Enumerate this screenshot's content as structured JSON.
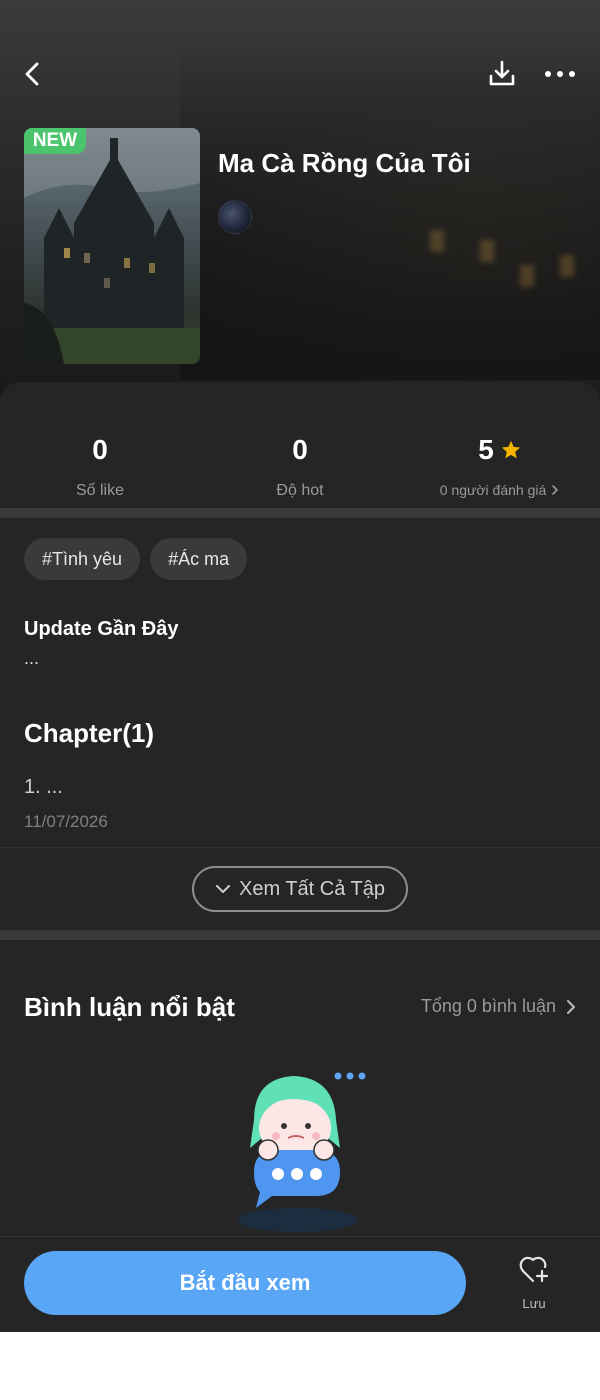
{
  "header": {
    "back_icon": "chevron-left-icon",
    "download_icon": "download-icon",
    "more_icon": "more-dots-icon"
  },
  "story": {
    "title": "Ma Cà Rồng Của Tôi",
    "badge": "NEW"
  },
  "stats": [
    {
      "value": "0",
      "label": "Số like"
    },
    {
      "value": "0",
      "label": "Độ hot"
    },
    {
      "value": "5",
      "label": "0 người đánh giá"
    }
  ],
  "tags": [
    "#Tình yêu",
    "#Ác ma"
  ],
  "update": {
    "title": "Update Gần Đây",
    "text": "..."
  },
  "chapters": {
    "title": "Chapter(1)",
    "items": [
      {
        "name": "1. ...",
        "date": "11/07/2026"
      }
    ],
    "see_all_label": "Xem Tất Cả Tập"
  },
  "comments": {
    "title": "Bình luận nổi bật",
    "total_label": "Tổng 0 bình luận"
  },
  "bottom": {
    "start_label": "Bắt đầu xem",
    "save_label": "Lưu"
  },
  "colors": {
    "background": "#252525",
    "primary": "#58a6f5",
    "badge": "#4cc46d",
    "star": "#f5b400"
  }
}
